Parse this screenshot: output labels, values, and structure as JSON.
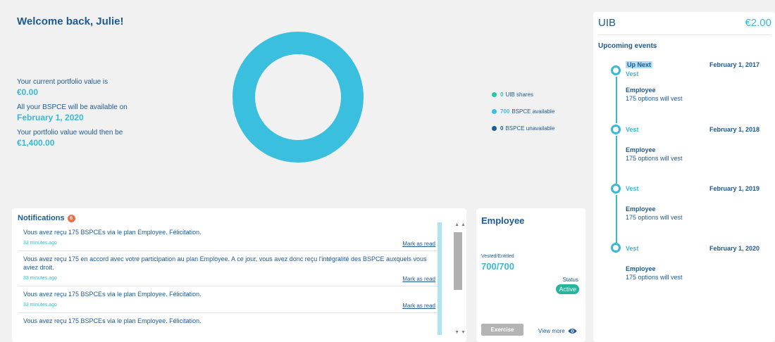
{
  "welcome": "Welcome back, Julie!",
  "portfolio": {
    "current_label": "Your current portfolio value is",
    "current_value": "€0.00",
    "available_label": "All your BSPCE will be available on",
    "available_date": "February 1, 2020",
    "future_label": "Your portfolio value would then be",
    "future_value": "€1,400.00"
  },
  "legend": [
    {
      "count": "0",
      "label": "UIB shares",
      "color": "#26c7b0"
    },
    {
      "count": "700",
      "label": "BSPCE available",
      "color": "#3bbfde"
    },
    {
      "count": "0",
      "label": "BSPCE unavailable",
      "color": "#1a5a96"
    }
  ],
  "notifications": {
    "title": "Notifications",
    "count": "6",
    "items": [
      {
        "message": "Vous avez reçu 175 BSPCEs via le plan Employee. Félicitation.",
        "time": "33 minutes ago",
        "action": "Mark as read"
      },
      {
        "message": "Vous avez reçu 175 en accord avec votre participation au plan Employee. A ce jour, vous avez donc reçu l'intégralité des BSPCE auxquels vous aviez droit.",
        "time": "33 minutes ago",
        "action": "Mark as read"
      },
      {
        "message": "Vous avez reçu 175 BSPCEs via le plan Employee. Félicitation.",
        "time": "33 minutes ago",
        "action": "Mark as read"
      },
      {
        "message": "Vous avez reçu 175 BSPCEs via le plan Employee. Félicitation.",
        "time": "",
        "action": ""
      }
    ]
  },
  "employee": {
    "title": "Employee",
    "vested_label": "Vested/Entitled",
    "vested_value": "700/700",
    "status_label": "Status",
    "status_value": "Active",
    "exercise_label": "Exercise",
    "view_more": "View more"
  },
  "uib": {
    "name": "UIB",
    "price": "€2.00",
    "upcoming_title": "Upcoming events",
    "events": [
      {
        "tag": "Up Next",
        "label": "Vest",
        "date": "February 1, 2017",
        "plan": "Employee",
        "desc": "175 options will vest"
      },
      {
        "tag": "",
        "label": "Vest",
        "date": "February 1, 2018",
        "plan": "Employee",
        "desc": "175 options will vest"
      },
      {
        "tag": "",
        "label": "Vest",
        "date": "February 1, 2019",
        "plan": "Employee",
        "desc": "175 options will vest"
      },
      {
        "tag": "",
        "label": "Vest",
        "date": "February 1, 2020",
        "plan": "Employee",
        "desc": "175 options will vest"
      }
    ]
  },
  "icons": {
    "eye": "eye-icon",
    "scroll_up": "chevron-up-icon",
    "scroll_down": "chevron-down-icon"
  }
}
